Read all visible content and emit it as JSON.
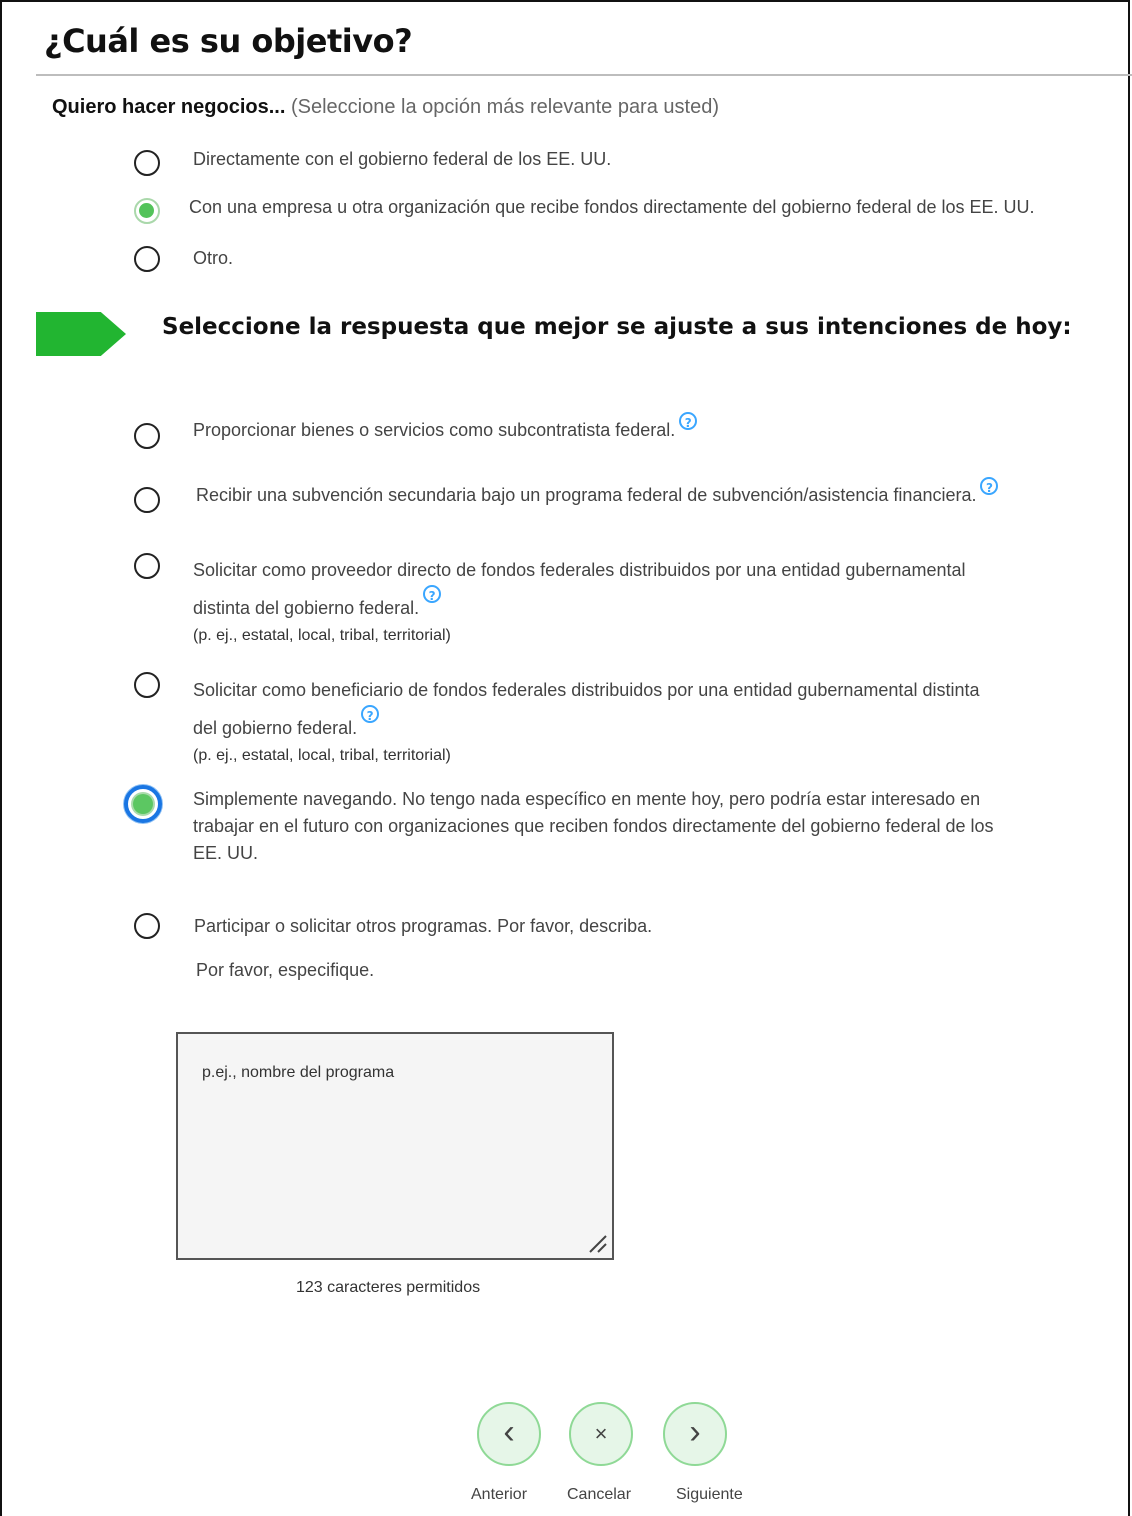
{
  "header": {
    "title": "¿Cuál es su objetivo?"
  },
  "intro": {
    "label": "Quiero hacer negocios...",
    "hint": "(Seleccione la opción más relevante para usted)"
  },
  "business_options": [
    {
      "label": "Directamente con el gobierno federal de los EE. UU.",
      "checked": false
    },
    {
      "label": "Con una empresa u otra organización que recibe fondos directamente del gobierno federal de los EE. UU.",
      "checked": true
    },
    {
      "label": "Otro.",
      "checked": false
    }
  ],
  "section": {
    "heading": "Seleccione la respuesta que mejor se ajuste a sus intenciones de hoy:"
  },
  "intent_options": [
    {
      "label": "Proporcionar bienes o servicios como subcontratista federal.",
      "help": "?",
      "checked": false
    },
    {
      "label": "Recibir una subvención secundaria bajo un programa federal de subvención/asistencia financiera.",
      "help": "?",
      "checked": false
    },
    {
      "label_line1": "Solicitar como proveedor directo de fondos federales distribuidos por una entidad gubernamental",
      "label_line2": "distinta del gobierno federal.",
      "sub": "(p. ej., estatal, local, tribal, territorial)",
      "help": "?",
      "checked": false
    },
    {
      "label_line1": "Solicitar como beneficiario de fondos federales distribuidos por una entidad gubernamental distinta",
      "label_line2": "del gobierno federal.",
      "sub": "(p. ej., estatal, local, tribal, territorial)",
      "help": "?",
      "checked": false
    },
    {
      "label_line1": "Simplemente navegando. No tengo nada específico en mente hoy, pero podría estar interesado en",
      "label_line2": "trabajar en el futuro con organizaciones que reciben fondos directamente del gobierno federal de los",
      "label_line3": "EE. UU.",
      "checked": true
    },
    {
      "label": "Participar o solicitar otros programas. Por favor, describa.",
      "sub": "Por favor, especifique.",
      "checked": false
    }
  ],
  "textarea": {
    "placeholder": "p.ej., nombre del programa",
    "value": "",
    "chars_text": "123 caracteres permitidos"
  },
  "nav": {
    "prev_label": "Anterior",
    "prev_icon": "‹",
    "cancel_label": "Cancelar",
    "cancel_icon": "×",
    "next_label": "Siguiente",
    "next_icon": "›"
  },
  "colors": {
    "accent_green": "#22b531",
    "radio_green": "#53c35a",
    "focus_blue": "#1a76e3",
    "help_blue": "#3aa6ff"
  }
}
